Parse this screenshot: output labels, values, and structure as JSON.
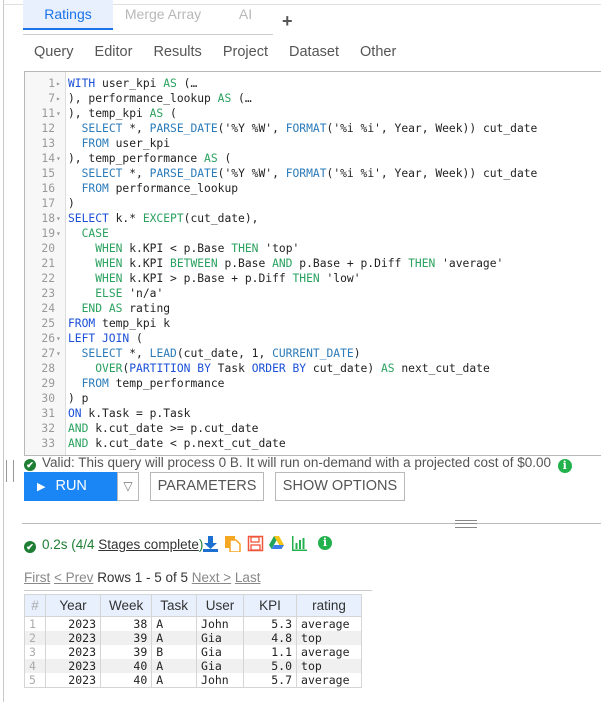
{
  "tabs": [
    {
      "label": "Ratings",
      "active": true
    },
    {
      "label": "Merge Array",
      "active": false
    },
    {
      "label": "AI",
      "active": false
    }
  ],
  "tab_add_label": "+",
  "menu": [
    "Query",
    "Editor",
    "Results",
    "Project",
    "Dataset",
    "Other"
  ],
  "editor": {
    "lines": [
      {
        "n": "1",
        "fold": "▸",
        "html": "<span class='kw'>WITH</span> user_kpi <span class='kg'>AS</span> (…"
      },
      {
        "n": "7",
        "fold": "▸",
        "html": "), performance_lookup <span class='kg'>AS</span> (…"
      },
      {
        "n": "11",
        "fold": "▾",
        "html": "), temp_kpi <span class='kg'>AS</span> ("
      },
      {
        "n": "12",
        "fold": "",
        "html": "  <span class='fn'>SELECT</span> *, <span class='fn'>PARSE_DATE</span>(<span class='st'>'%Y %W'</span>, <span class='fn'>FORMAT</span>(<span class='st'>'%i %i'</span>, Year, Week)) cut_date"
      },
      {
        "n": "13",
        "fold": "",
        "html": "  <span class='fn'>FROM</span> user_kpi"
      },
      {
        "n": "14",
        "fold": "▾",
        "html": "), temp_performance <span class='kg'>AS</span> ("
      },
      {
        "n": "15",
        "fold": "",
        "html": "  <span class='fn'>SELECT</span> *, <span class='fn'>PARSE_DATE</span>(<span class='st'>'%Y %W'</span>, <span class='fn'>FORMAT</span>(<span class='st'>'%i %i'</span>, Year, Week)) cut_date"
      },
      {
        "n": "16",
        "fold": "",
        "html": "  <span class='fn'>FROM</span> performance_lookup"
      },
      {
        "n": "17",
        "fold": "",
        "html": ")"
      },
      {
        "n": "18",
        "fold": "▾",
        "html": "<span class='kw'>SELECT</span> k.* <span class='kg'>EXCEPT</span>(cut_date),"
      },
      {
        "n": "19",
        "fold": "▾",
        "html": "  <span class='kg'>CASE</span>"
      },
      {
        "n": "20",
        "fold": "",
        "html": "    <span class='kg'>WHEN</span> k.KPI &lt; p.Base <span class='kg'>THEN</span> 'top'"
      },
      {
        "n": "21",
        "fold": "",
        "html": "    <span class='kg'>WHEN</span> k.KPI <span class='kg'>BETWEEN</span> p.Base <span class='kg'>AND</span> p.Base + p.Diff <span class='kg'>THEN</span> 'average'"
      },
      {
        "n": "22",
        "fold": "",
        "html": "    <span class='kg'>WHEN</span> k.KPI &gt; p.Base + p.Diff <span class='kg'>THEN</span> 'low'"
      },
      {
        "n": "23",
        "fold": "",
        "html": "    <span class='kg'>ELSE</span> 'n/a'"
      },
      {
        "n": "24",
        "fold": "",
        "html": "  <span class='kg'>END</span> <span class='kg'>AS</span> rating"
      },
      {
        "n": "25",
        "fold": "",
        "html": "<span class='kw'>FROM</span> temp_kpi k"
      },
      {
        "n": "26",
        "fold": "▾",
        "html": "<span class='kw'>LEFT JOIN</span> ("
      },
      {
        "n": "27",
        "fold": "▾",
        "html": "  <span class='fn'>SELECT</span> *, <span class='fn'>LEAD</span>(cut_date, 1, <span class='fn'>CURRENT_DATE</span>)"
      },
      {
        "n": "28",
        "fold": "",
        "html": "    <span class='kg'>OVER</span>(<span class='kw'>PARTITION BY</span> Task <span class='kw'>ORDER BY</span> cut_date) <span class='kg'>AS</span> next_cut_date"
      },
      {
        "n": "29",
        "fold": "",
        "html": "  <span class='fn'>FROM</span> temp_performance"
      },
      {
        "n": "30",
        "fold": "",
        "html": ") p"
      },
      {
        "n": "31",
        "fold": "",
        "html": "<span class='kw'>ON</span> k.Task = p.Task"
      },
      {
        "n": "32",
        "fold": "",
        "html": "<span class='kg'>AND</span> k.cut_date &gt;= p.cut_date"
      },
      {
        "n": "33",
        "fold": "",
        "html": "<span class='kg'>AND</span> k.cut_date &lt; p.next_cut_date"
      }
    ]
  },
  "validation": {
    "text": "Valid: This query will process 0 B. It will run on-demand with a projected cost of $0.00",
    "icon": "check-circle-icon",
    "info_icon": "info-icon"
  },
  "buttons": {
    "run": "RUN",
    "run_dropdown": "▽",
    "parameters": "PARAMETERS",
    "show_options": "SHOW OPTIONS"
  },
  "results_status": {
    "time": "0.2s (4/4 ",
    "stages_link": "Stages complete",
    "close_paren": ")",
    "tools": [
      "download-icon",
      "copy-icon",
      "save-icon",
      "google-drive-icon",
      "chart-icon",
      "info-icon"
    ],
    "colors": {
      "download": "#1a6fd0",
      "copy": "#f5a623",
      "save": "#f0553a",
      "chart": "#22b14c",
      "info": "#22b14c"
    }
  },
  "pager": {
    "first": "First",
    "prev": "< Prev",
    "rows": "Rows 1 - 5 of 5",
    "next": "Next >",
    "last": "Last"
  },
  "table": {
    "columns": [
      "#",
      "Year",
      "Week",
      "Task",
      "User",
      "KPI",
      "rating"
    ],
    "rows": [
      [
        "1",
        "2023",
        "38",
        "A",
        "John",
        "5.3",
        "average"
      ],
      [
        "2",
        "2023",
        "39",
        "A",
        "Gia",
        "4.8",
        "top"
      ],
      [
        "3",
        "2023",
        "39",
        "B",
        "Gia",
        "1.1",
        "average"
      ],
      [
        "4",
        "2023",
        "40",
        "A",
        "Gia",
        "5.0",
        "top"
      ],
      [
        "5",
        "2023",
        "40",
        "A",
        "John",
        "5.7",
        "average"
      ]
    ]
  }
}
